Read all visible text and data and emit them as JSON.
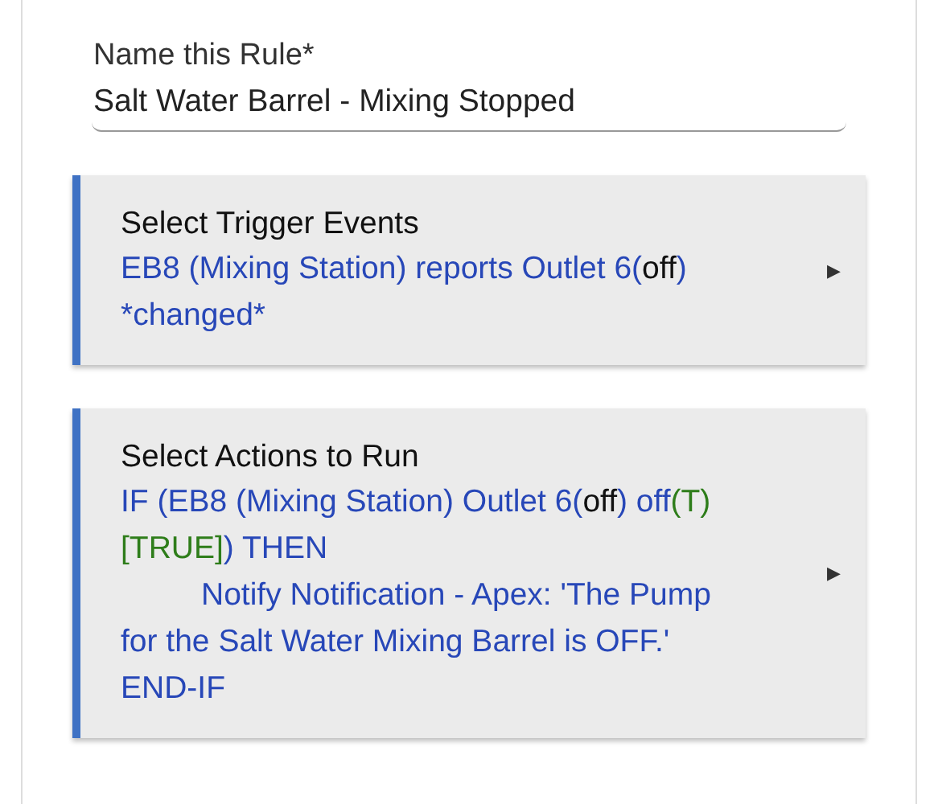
{
  "name_field": {
    "label": "Name this Rule*",
    "value": "Salt Water Barrel - Mixing Stopped"
  },
  "sections": [
    {
      "title": "Select Trigger Events",
      "arrow": "▶",
      "lines": [
        [
          {
            "kind": "plain",
            "text": "EB8 (Mixing Station) reports Outlet 6("
          },
          {
            "kind": "state",
            "text": "off"
          },
          {
            "kind": "plain",
            "text": ")"
          }
        ],
        [
          {
            "kind": "plain",
            "text": "*changed*"
          }
        ]
      ]
    },
    {
      "title": "Select Actions to Run",
      "arrow": "▶",
      "lines": [
        [
          {
            "kind": "plain",
            "text": "IF (EB8 (Mixing Station) Outlet 6("
          },
          {
            "kind": "state",
            "text": "off"
          },
          {
            "kind": "plain",
            "text": ") off"
          },
          {
            "kind": "truth",
            "text": "(T)"
          }
        ],
        [
          {
            "kind": "truth",
            "text": "[TRUE]"
          },
          {
            "kind": "plain",
            "text": ") THEN"
          }
        ],
        [
          {
            "kind": "indent",
            "text": "Notify Notification - Apex: 'The Pump"
          }
        ],
        [
          {
            "kind": "plain",
            "text": "for the Salt Water Mixing Barrel is OFF.'"
          }
        ],
        [
          {
            "kind": "plain",
            "text": "END-IF"
          }
        ]
      ]
    }
  ]
}
